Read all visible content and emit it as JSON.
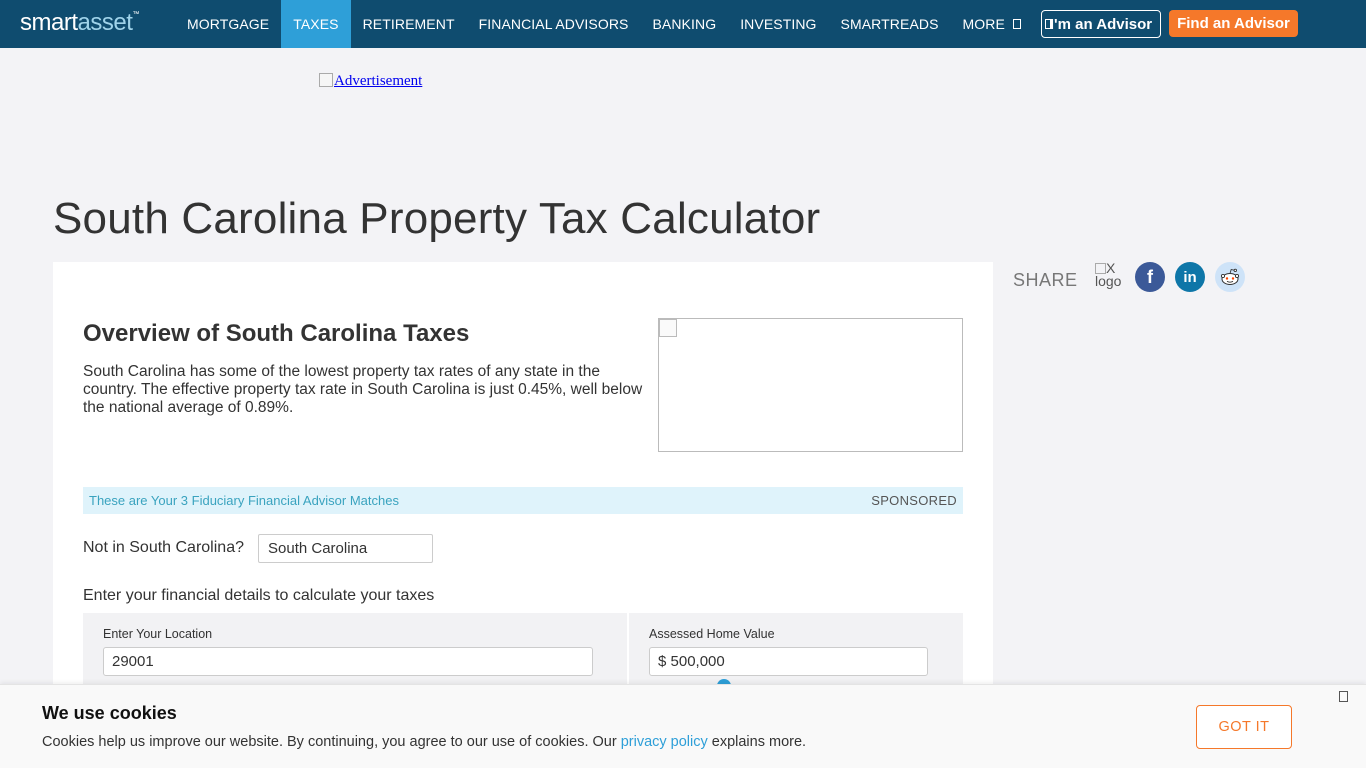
{
  "nav": {
    "logo_smart": "smart",
    "logo_asset": "asset",
    "logo_tm": "™",
    "items": [
      {
        "label": "MORTGAGE"
      },
      {
        "label": "TAXES"
      },
      {
        "label": "RETIREMENT"
      },
      {
        "label": "FINANCIAL ADVISORS"
      },
      {
        "label": "BANKING"
      },
      {
        "label": "INVESTING"
      },
      {
        "label": "SMARTREADS"
      },
      {
        "label": "MORE"
      }
    ],
    "active_item": "TAXES",
    "advisor_button": "I'm an Advisor",
    "find_button": "Find an Advisor",
    "colors": {
      "bar": "#0f4c6f",
      "active": "#2e9fd8",
      "find": "#f5782a"
    }
  },
  "ad": {
    "label": "Advertisement"
  },
  "page_title": "South Carolina Property Tax Calculator",
  "overview": {
    "title": "Overview of South Carolina Taxes",
    "text": "South Carolina has some of the lowest property tax rates of any state in the country. The effective property tax rate in South Carolina is just 0.45%, well below the national average of 0.89%."
  },
  "sponsored": {
    "left": "These are Your 3 Fiduciary Financial Advisor Matches",
    "right": "SPONSORED"
  },
  "state_selector": {
    "label": "Not in South Carolina?",
    "value": "South Carolina"
  },
  "details_prompt": "Enter your financial details to calculate your taxes",
  "fields": {
    "location": {
      "label": "Enter Your Location",
      "value": "29001"
    },
    "home_value": {
      "label": "Assessed Home Value",
      "value": "$ 500,000"
    }
  },
  "share": {
    "label": "SHARE",
    "x_alt": "X logo",
    "facebook_glyph": "f",
    "linkedin_glyph": "in"
  },
  "cookie": {
    "title": "We use cookies",
    "text_before": "Cookies help us improve our website. By continuing, you agree to our use of cookies. Our ",
    "link": "privacy policy",
    "text_after": " explains more.",
    "button": "GOT IT"
  }
}
